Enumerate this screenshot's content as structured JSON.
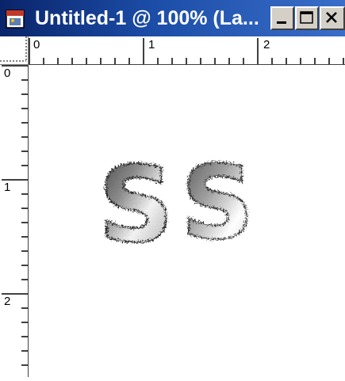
{
  "window": {
    "title": "Untitled-1 @ 100% (La..."
  },
  "title_controls": {
    "minimize_icon": "minimize-icon",
    "maximize_icon": "maximize-icon",
    "close_icon": "close-icon"
  },
  "rulers": {
    "horizontal_labels": [
      "0",
      "1",
      "2"
    ],
    "vertical_labels": [
      "0",
      "1",
      "2"
    ]
  },
  "canvas": {
    "artwork_text": "SS",
    "background": "#ffffff"
  },
  "colors": {
    "titlebar_start": "#0a246a",
    "titlebar_end": "#3a6ec8",
    "chrome": "#d4d0c8"
  }
}
